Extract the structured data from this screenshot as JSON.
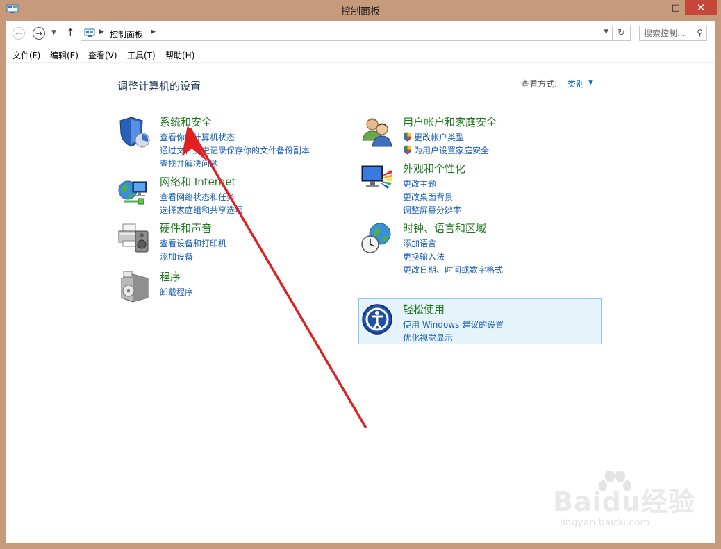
{
  "window": {
    "title": "控制面板",
    "min_glyph": "—",
    "max_glyph": "□",
    "close_glyph": "✕"
  },
  "nav": {
    "breadcrumb": "控制面板",
    "search_placeholder": "搜索控制..."
  },
  "menu": [
    "文件(F)",
    "编辑(E)",
    "查看(V)",
    "工具(T)",
    "帮助(H)"
  ],
  "content": {
    "heading": "调整计算机的设置",
    "view_by_label": "查看方式:",
    "view_by_value": "类别"
  },
  "categories": {
    "system": {
      "title": "系统和安全",
      "links": [
        "查看你的计算机状态",
        "通过文件历史记录保存你的文件备份副本",
        "查找并解决问题"
      ]
    },
    "network": {
      "title": "网络和 Internet",
      "links": [
        "查看网络状态和任务",
        "选择家庭组和共享选项"
      ]
    },
    "hardware": {
      "title": "硬件和声音",
      "links": [
        "查看设备和打印机",
        "添加设备"
      ]
    },
    "programs": {
      "title": "程序",
      "links": [
        "卸载程序"
      ]
    },
    "accounts": {
      "title": "用户帐户和家庭安全",
      "links": [
        "更改帐户类型",
        "为用户设置家庭安全"
      ]
    },
    "appearance": {
      "title": "外观和个性化",
      "links": [
        "更改主题",
        "更改桌面背景",
        "调整屏幕分辨率"
      ]
    },
    "clock": {
      "title": "时钟、语言和区域",
      "links": [
        "添加语言",
        "更换输入法",
        "更改日期、时间或数字格式"
      ]
    },
    "ease": {
      "title": "轻松使用",
      "links": [
        "使用 Windows 建议的设置",
        "优化视觉显示"
      ]
    }
  },
  "watermark": {
    "logo": "Baidu经验",
    "url": "jingyan.baidu.com"
  },
  "colors": {
    "frame": "#c89a7c",
    "close": "#c7463a",
    "category_title": "#1c7a1c",
    "link": "#1a5fb4",
    "arrow": "#e02020",
    "highlight_bg": "#e5f3fb"
  }
}
